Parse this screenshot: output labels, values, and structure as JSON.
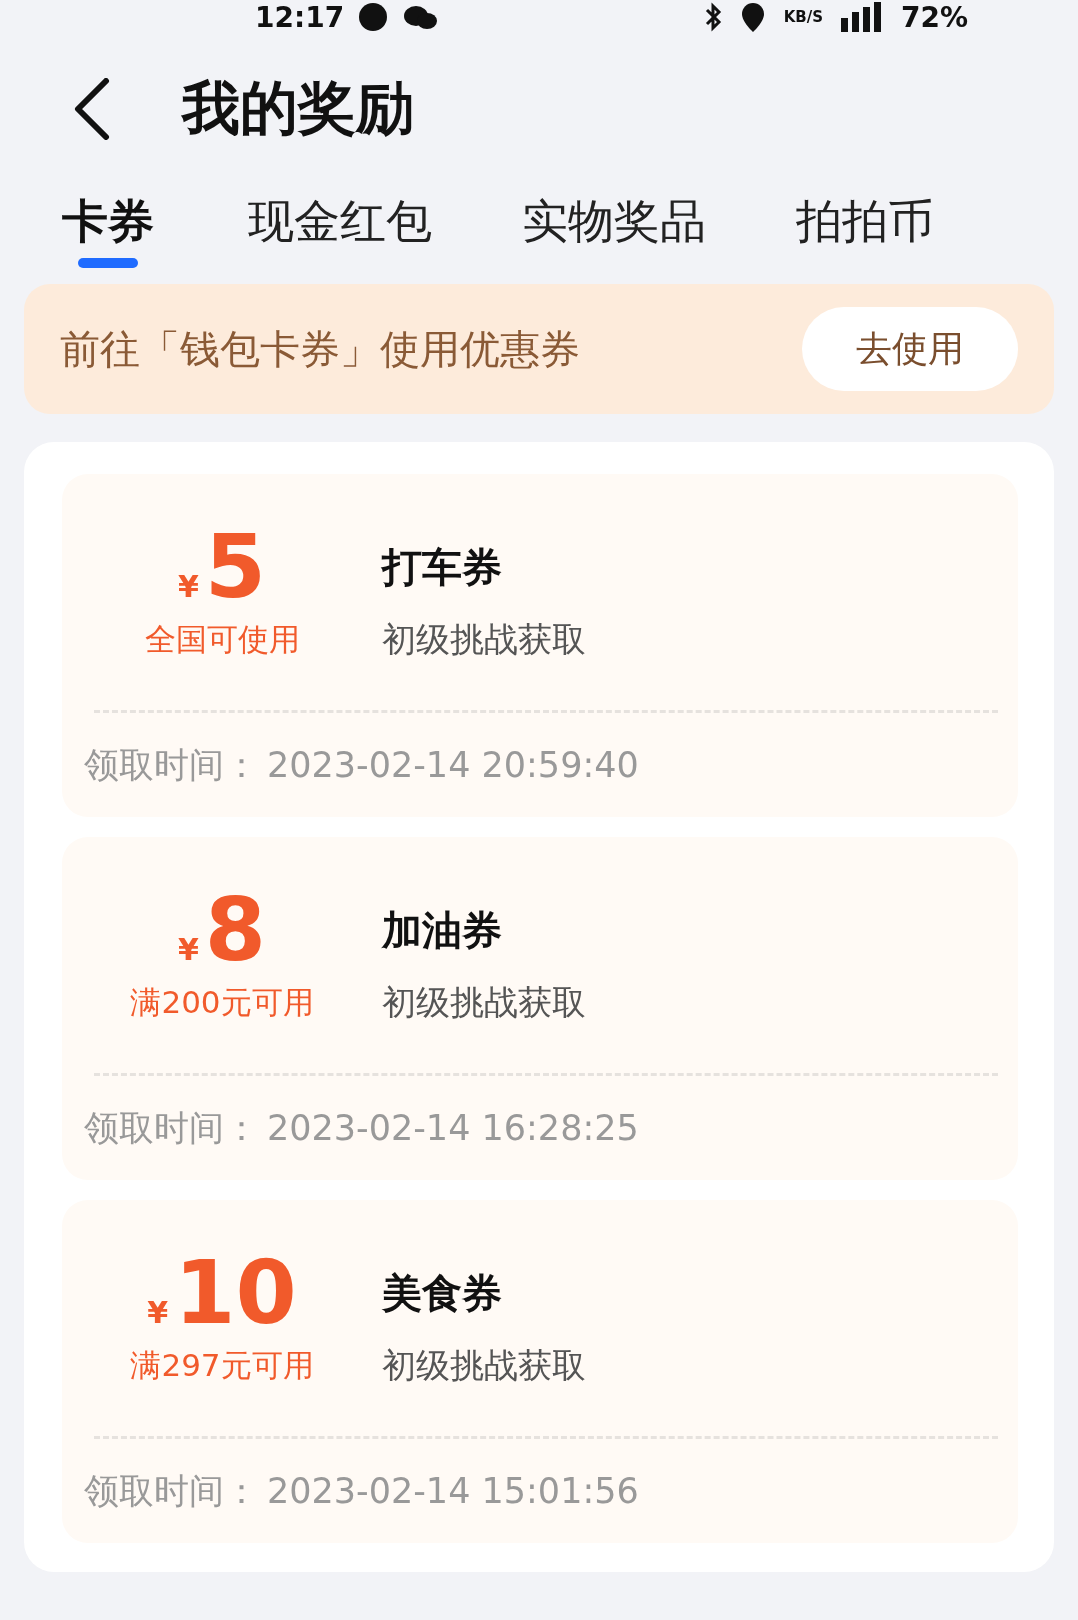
{
  "status_bar": {
    "time": "12:17",
    "speed_unit": "KB/S",
    "battery": "72%"
  },
  "header": {
    "title": "我的奖励"
  },
  "tabs": [
    {
      "label": "卡券",
      "selected": true
    },
    {
      "label": "现金红包",
      "selected": false
    },
    {
      "label": "实物奖品",
      "selected": false
    },
    {
      "label": "拍拍币",
      "selected": false
    }
  ],
  "banner": {
    "text": "前往「钱包卡券」使用优惠券",
    "button": "去使用"
  },
  "coupons": [
    {
      "currency": "¥",
      "amount": "5",
      "condition": "全国可使用",
      "name": "打车券",
      "source": "初级挑战获取",
      "time_label": "领取时间：",
      "time": "2023-02-14 20:59:40"
    },
    {
      "currency": "¥",
      "amount": "8",
      "condition": "满200元可用",
      "name": "加油券",
      "source": "初级挑战获取",
      "time_label": "领取时间：",
      "time": "2023-02-14 16:28:25"
    },
    {
      "currency": "¥",
      "amount": "10",
      "condition": "满297元可用",
      "name": "美食券",
      "source": "初级挑战获取",
      "time_label": "领取时间：",
      "time": "2023-02-14 15:01:56"
    }
  ]
}
